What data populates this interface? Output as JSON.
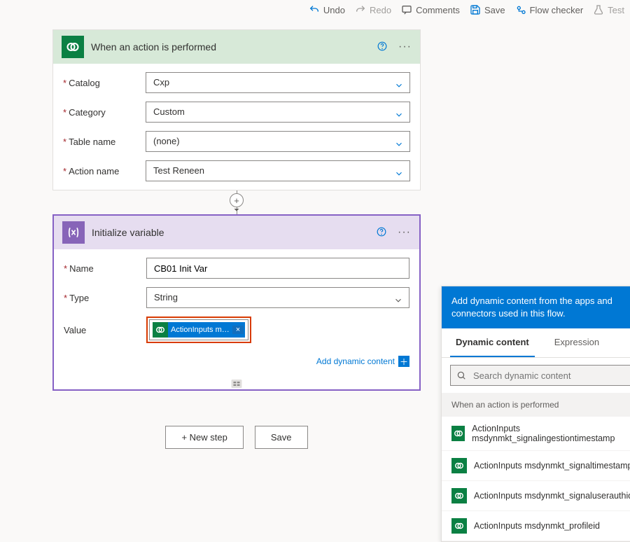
{
  "toolbar": {
    "undo": "Undo",
    "redo": "Redo",
    "comments": "Comments",
    "save": "Save",
    "flow_checker": "Flow checker",
    "test": "Test"
  },
  "trigger": {
    "title": "When an action is performed",
    "fields": {
      "catalog": {
        "label": "Catalog",
        "value": "Cxp"
      },
      "category": {
        "label": "Category",
        "value": "Custom"
      },
      "table": {
        "label": "Table name",
        "value": "(none)"
      },
      "action": {
        "label": "Action name",
        "value": "Test Reneen"
      }
    }
  },
  "action1": {
    "title": "Initialize variable",
    "fields": {
      "name": {
        "label": "Name",
        "value": "CB01 Init Var"
      },
      "type": {
        "label": "Type",
        "value": "String"
      },
      "value_label": "Value",
      "pill": "ActionInputs m…",
      "pill_x": "×"
    },
    "add_dynamic": "Add dynamic content"
  },
  "buttons": {
    "new_step": "+ New step",
    "save": "Save"
  },
  "dyn": {
    "header": "Add dynamic content from the apps and connectors used in this flow.",
    "tab_dynamic": "Dynamic content",
    "tab_expression": "Expression",
    "search_placeholder": "Search dynamic content",
    "section": "When an action is performed",
    "items": [
      "ActionInputs msdynmkt_signalingestiontimestamp",
      "ActionInputs msdynmkt_signaltimestamp",
      "ActionInputs msdynmkt_signaluserauthid",
      "ActionInputs msdynmkt_profileid"
    ]
  }
}
